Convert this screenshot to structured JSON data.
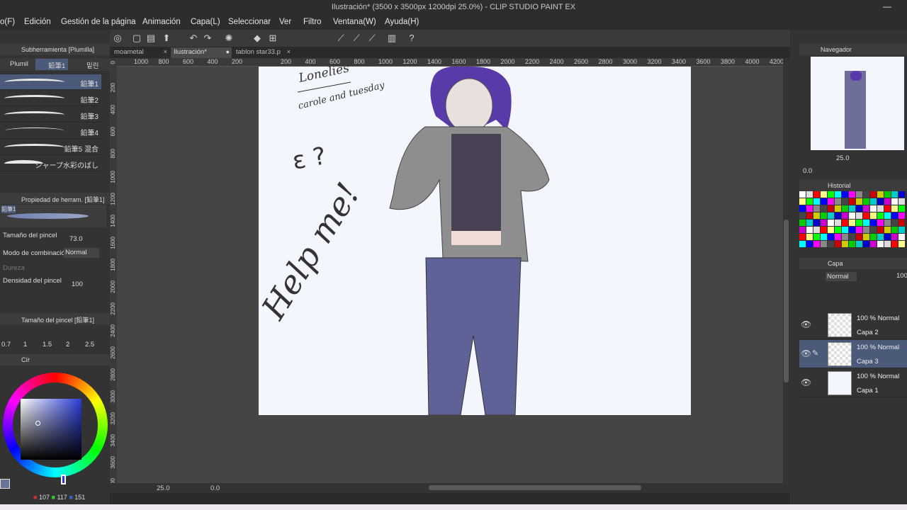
{
  "window": {
    "title": "Ilustración* (3500 x 3500px 1200dpi 25.0%) - CLIP STUDIO PAINT EX",
    "minimize": "—"
  },
  "menu": [
    "o(F)",
    "Edición",
    "Gestión de la página",
    "Animación",
    "Capa(L)",
    "Seleccionar",
    "Ver",
    "Filtro",
    "Ventana(W)",
    "Ayuda(H)"
  ],
  "tabs": [
    {
      "label": "moametal",
      "close": "×"
    },
    {
      "label": "Ilustración*",
      "close": "●"
    },
    {
      "label": "tablon star33.p",
      "close": "×"
    }
  ],
  "ruler_h": [
    "1000",
    "800",
    "600",
    "400",
    "200",
    "",
    "200",
    "400",
    "600",
    "800",
    "1000",
    "1200",
    "1400",
    "1600",
    "1800",
    "2000",
    "2200",
    "2400",
    "2600",
    "2800",
    "3000",
    "3200",
    "3400",
    "3600",
    "3800",
    "4000",
    "4200"
  ],
  "ruler_v": [
    "0",
    "200",
    "400",
    "600",
    "800",
    "1000",
    "1200",
    "1400",
    "1600",
    "1800",
    "2000",
    "2200",
    "2400",
    "2600",
    "2800",
    "3000",
    "3200",
    "3400",
    "3600",
    "3800"
  ],
  "left": {
    "subtool_header": "Subherramienta [Plumilla]",
    "subtool_tabs": [
      "Plumil",
      "鉛筆1",
      "밑린"
    ],
    "brushes": [
      "鉛筆1",
      "鉛筆2",
      "鉛筆3",
      "鉛筆4",
      "鉛筆5 混合",
      "シャープ水彩のばし"
    ],
    "tool_property_header": "Propiedad de herram. [鉛筆1]",
    "brush_preview_label": "鉛筆1",
    "brush_size_label": "Tamaño del pincel",
    "brush_size_value": "73.0",
    "blend_label": "Modo de combinación",
    "blend_value": "Normal",
    "hardness_label": "Dureza",
    "density_label": "Densidad del pincel",
    "density_value": "100",
    "size_palette_header": "Tamaño del pincel [鉛筆1]",
    "sizes": [
      "0.7",
      "1",
      "1.5",
      "2",
      "2.5"
    ],
    "color_header": "Cír",
    "rgb": {
      "r": "107",
      "g": "117",
      "b": "151"
    }
  },
  "right": {
    "navigator_label": "Navegador",
    "zoom": "25.0",
    "rotation": "0.0",
    "history_label": "Historial",
    "layer_label": "Capa",
    "blend_mode": "Normal",
    "opacity": "100",
    "layers": [
      {
        "mode": "100 % Normal",
        "name": "Capa 2",
        "selected": false
      },
      {
        "mode": "100 % Normal",
        "name": "Capa 3",
        "selected": true
      },
      {
        "mode": "100 % Normal",
        "name": "Capa 1",
        "selected": false
      }
    ]
  },
  "status": {
    "zoom": "25.0",
    "rotation": "0.0"
  },
  "canvas_text": {
    "line1": "Lonelies",
    "line2": "carole and tuesday",
    "help": "Help me!",
    "eh": "ε ?"
  },
  "colors": {
    "accent": "#4a5a78",
    "paper": "#f3f6fd",
    "hair": "#5a3aa8",
    "jeans": "#5f6296",
    "hoodie": "#8e8e8e"
  }
}
